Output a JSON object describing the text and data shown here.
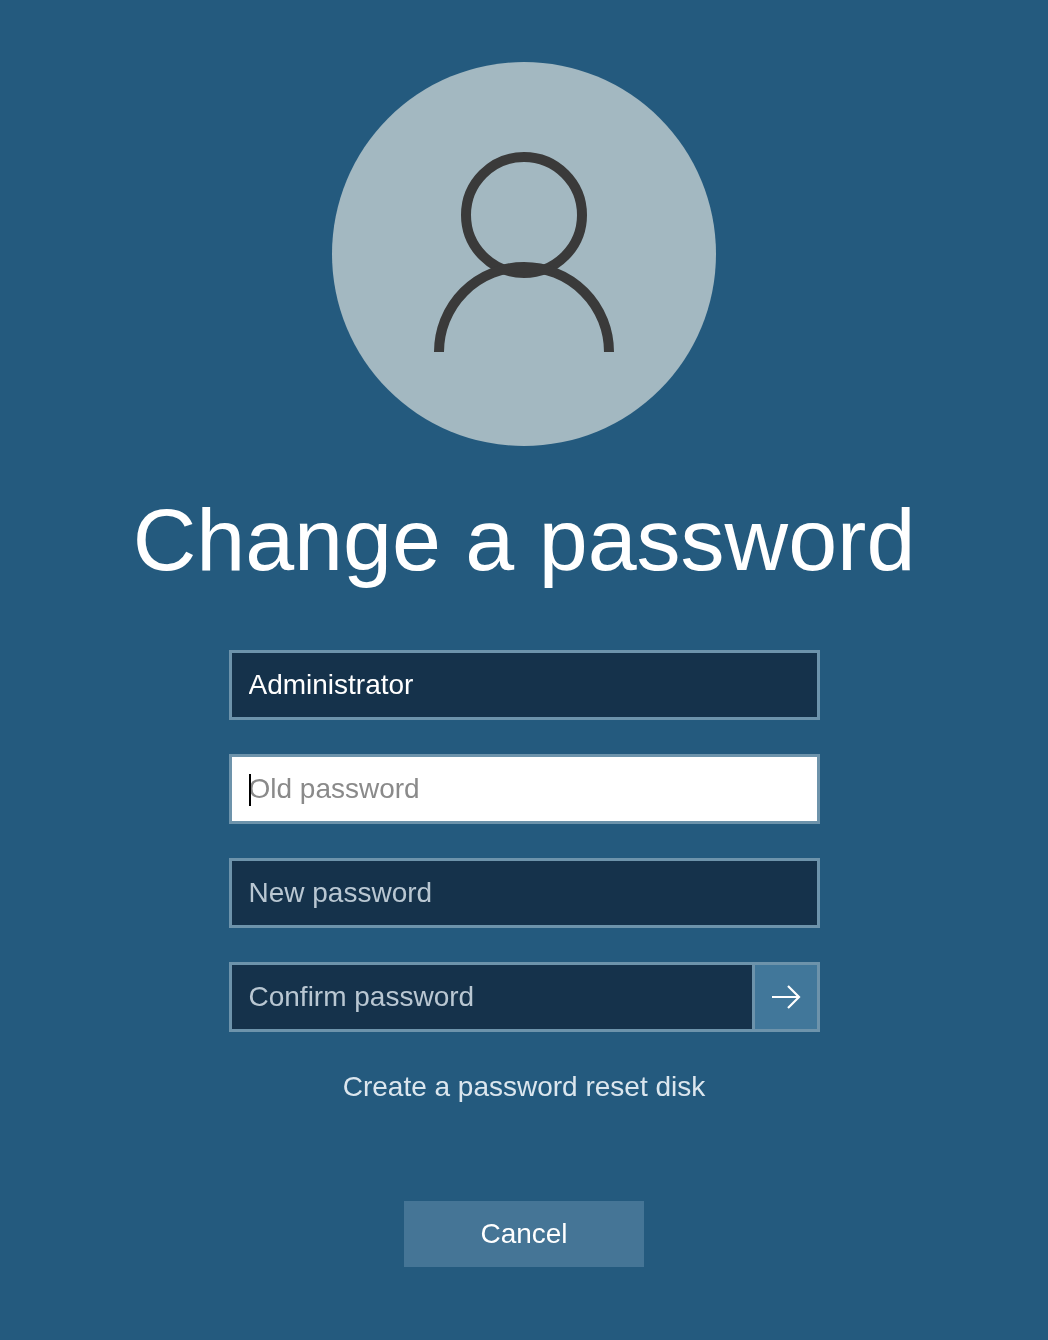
{
  "title": "Change a password",
  "fields": [
    {
      "kind": "text",
      "value": "Administrator",
      "focused": false
    },
    {
      "kind": "password",
      "placeholder": "Old password",
      "focused": true
    },
    {
      "kind": "password",
      "placeholder": "New password",
      "focused": false
    },
    {
      "kind": "password_submit",
      "placeholder": "Confirm password",
      "focused": false
    }
  ],
  "link": "Create a password reset disk",
  "cancel_button": "Cancel"
}
